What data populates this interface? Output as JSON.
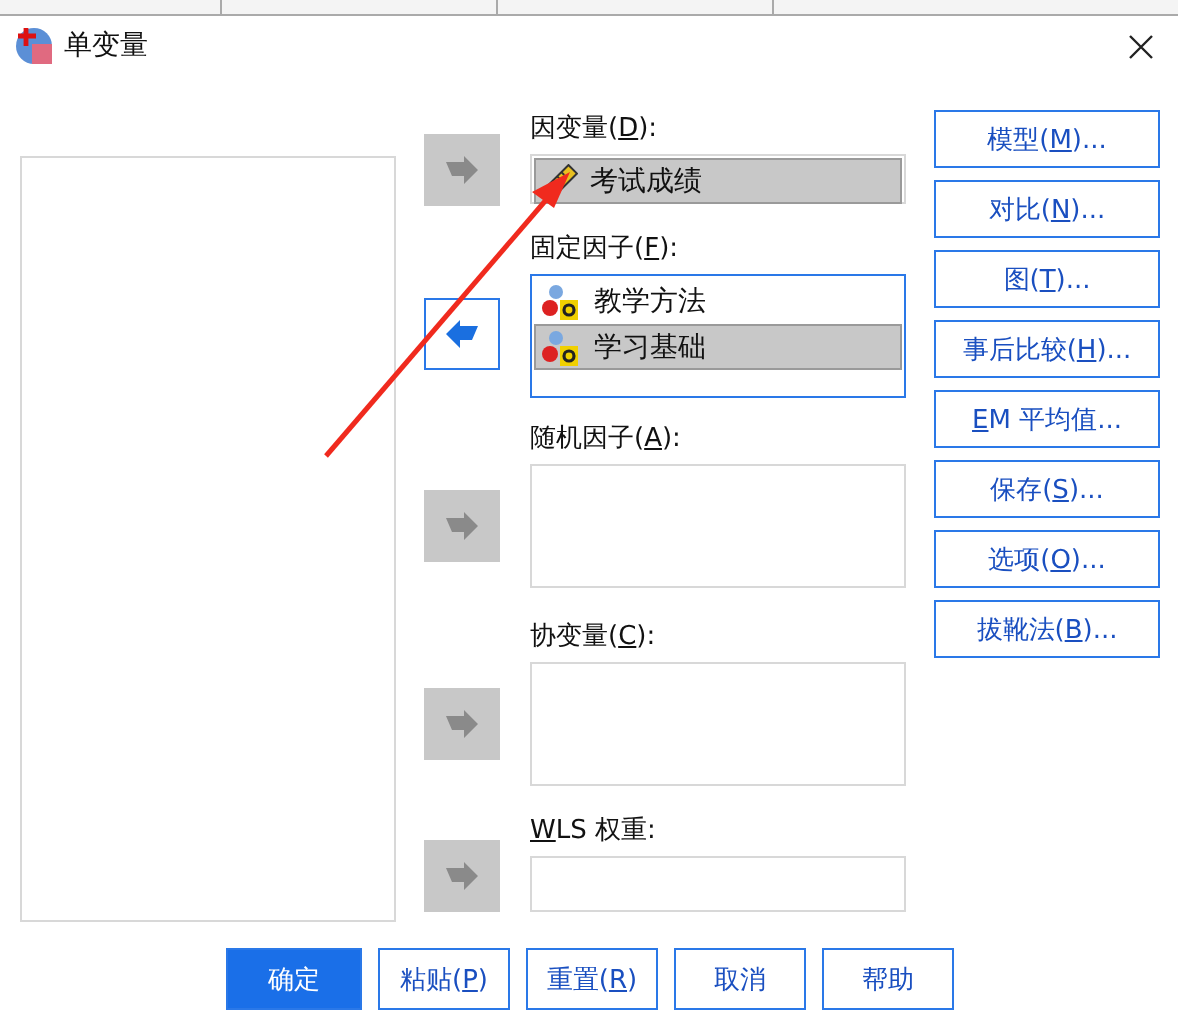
{
  "window": {
    "title": "单变量"
  },
  "sections": [
    {
      "label": {
        "before": "因变量(",
        "key": "D",
        "after": "):"
      },
      "arrow": {
        "points_left": false,
        "enabled": false
      },
      "focused": false,
      "items": [
        {
          "name": "考试成绩",
          "kind": "scale",
          "selected": true
        }
      ]
    },
    {
      "label": {
        "before": "固定因子(",
        "key": "F",
        "after": "):"
      },
      "arrow": {
        "points_left": true,
        "enabled": true
      },
      "focused": true,
      "items": [
        {
          "name": "教学方法",
          "kind": "nominal",
          "selected": false
        },
        {
          "name": "学习基础",
          "kind": "nominal",
          "selected": true
        }
      ]
    },
    {
      "label": {
        "before": "随机因子(",
        "key": "A",
        "after": "):"
      },
      "arrow": {
        "points_left": false,
        "enabled": false
      },
      "focused": false
    },
    {
      "label": {
        "before": "协变量(",
        "key": "C",
        "after": "):"
      },
      "arrow": {
        "points_left": false,
        "enabled": false
      },
      "focused": false
    },
    {
      "label": {
        "key": "W",
        "after": "LS 权重:"
      },
      "arrow": {
        "points_left": false,
        "enabled": false
      },
      "focused": false
    }
  ],
  "side_buttons": [
    {
      "before": "模型(",
      "key": "M",
      "after": ")..."
    },
    {
      "before": "对比(",
      "key": "N",
      "after": ")..."
    },
    {
      "before": "图(",
      "key": "T",
      "after": ")..."
    },
    {
      "before": "事后比较(",
      "key": "H",
      "after": ")..."
    },
    {
      "key": "E",
      "after": "M 平均值..."
    },
    {
      "before": "保存(",
      "key": "S",
      "after": ")..."
    },
    {
      "before": "选项(",
      "key": "O",
      "after": ")..."
    },
    {
      "before": "拔靴法(",
      "key": "B",
      "after": ")..."
    }
  ],
  "bottom_buttons": [
    {
      "label": {
        "before": "确定"
      },
      "default": true
    },
    {
      "label": {
        "before": "粘贴(",
        "key": "P",
        "after": ")"
      },
      "default": false
    },
    {
      "label": {
        "before": "重置(",
        "key": "R",
        "after": ")"
      },
      "default": false
    },
    {
      "label": {
        "before": "取消"
      },
      "default": false
    },
    {
      "label": {
        "before": "帮助"
      },
      "default": false
    }
  ],
  "annotation": {
    "kind": "arrow"
  }
}
